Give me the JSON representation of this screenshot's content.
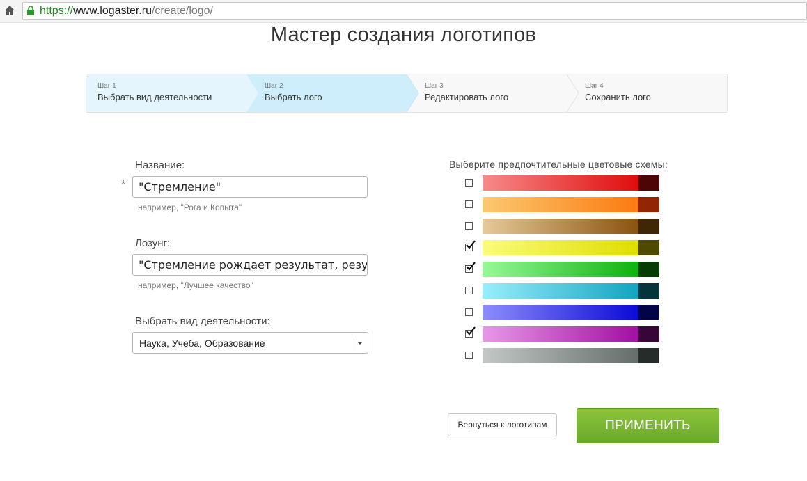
{
  "browser": {
    "url_scheme": "https://",
    "url_host": "www.logaster.ru",
    "url_path": "/create/logo/"
  },
  "page": {
    "title": "Мастер создания логотипов"
  },
  "steps": [
    {
      "number": "Шаг 1",
      "label": "Выбрать вид деятельности",
      "state": "done"
    },
    {
      "number": "Шаг 2",
      "label": "Выбрать лого",
      "state": "active"
    },
    {
      "number": "Шаг 3",
      "label": "Редактировать лого",
      "state": "pending"
    },
    {
      "number": "Шаг 4",
      "label": "Сохранить лого",
      "state": "pending"
    }
  ],
  "form": {
    "name": {
      "label": "Название:",
      "required_mark": "*",
      "value": "\"Стремление\"",
      "hint": "например, \"Рога и Копыта\""
    },
    "slogan": {
      "label": "Лозунг:",
      "value": "\"Стремление рождает результат, резул",
      "hint": "например, \"Лучшее качество\""
    },
    "activity": {
      "label": "Выбрать вид деятельности:",
      "selected": "Наука, Учеба, Образование"
    }
  },
  "color_schemes": {
    "title": "Выберите предпочтительные цветовые схемы:",
    "items": [
      {
        "name": "red",
        "checked": false,
        "gradient_from": "#f78a8a",
        "gradient_to": "#e00c0c",
        "dark": "#4e0505"
      },
      {
        "name": "orange",
        "checked": false,
        "gradient_from": "#fbc870",
        "gradient_to": "#fb7a10",
        "dark": "#922604"
      },
      {
        "name": "brown",
        "checked": false,
        "gradient_from": "#e6ca98",
        "gradient_to": "#8a5310",
        "dark": "#3f2604"
      },
      {
        "name": "yellow",
        "checked": true,
        "gradient_from": "#fbfb7a",
        "gradient_to": "#dede00",
        "dark": "#4e4b00"
      },
      {
        "name": "green",
        "checked": true,
        "gradient_from": "#98f898",
        "gradient_to": "#0eb20e",
        "dark": "#043c04"
      },
      {
        "name": "cyan",
        "checked": false,
        "gradient_from": "#98eefb",
        "gradient_to": "#12a4c0",
        "dark": "#04343c"
      },
      {
        "name": "blue",
        "checked": false,
        "gradient_from": "#8d8dfb",
        "gradient_to": "#0a0ad6",
        "dark": "#030348"
      },
      {
        "name": "purple",
        "checked": true,
        "gradient_from": "#e898e8",
        "gradient_to": "#a20ea2",
        "dark": "#380538"
      },
      {
        "name": "gray",
        "checked": false,
        "gradient_from": "#c3c8c6",
        "gradient_to": "#646e69",
        "dark": "#262c29"
      }
    ]
  },
  "buttons": {
    "back_label": "Вернуться к логотипам",
    "apply_label": "ПРИМЕНИТЬ"
  },
  "colors": {
    "active_step": "#cfeefc",
    "done_step": "#e4f5fd",
    "apply_green": "#7ab634",
    "url_green": "#1a8a1a"
  }
}
